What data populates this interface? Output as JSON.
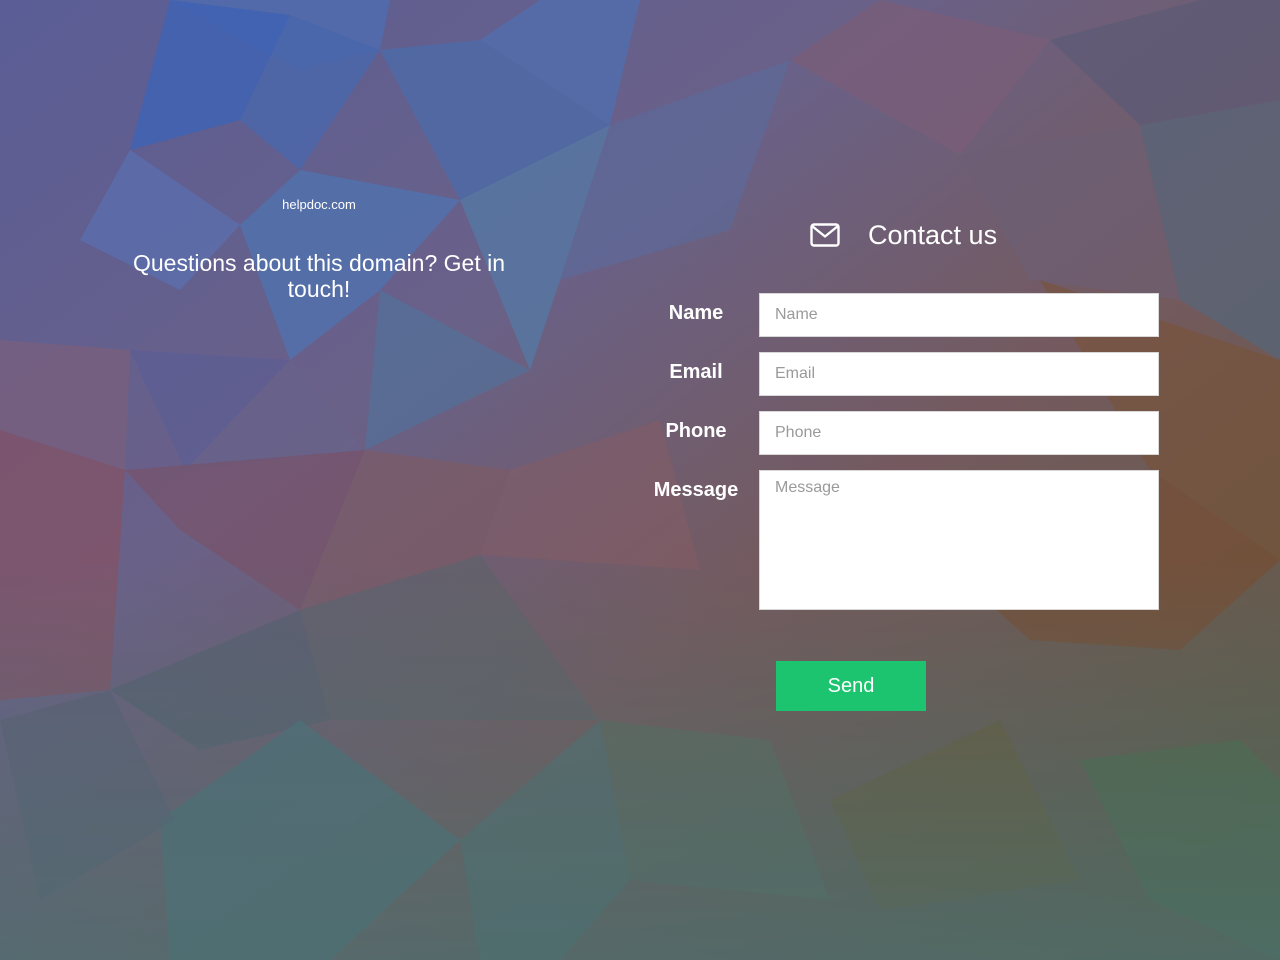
{
  "site": {
    "domain": "helpdoc.com",
    "tagline": "Questions about this domain? Get in touch!"
  },
  "contact": {
    "title": "Contact us",
    "icon": "envelope-icon",
    "fields": {
      "name": {
        "label": "Name",
        "placeholder": "Name",
        "value": ""
      },
      "email": {
        "label": "Email",
        "placeholder": "Email",
        "value": ""
      },
      "phone": {
        "label": "Phone",
        "placeholder": "Phone",
        "value": ""
      },
      "message": {
        "label": "Message",
        "placeholder": "Message",
        "value": ""
      }
    },
    "send_label": "Send"
  },
  "colors": {
    "send_button": "#1dc46f",
    "text": "#ffffff",
    "field_background": "#ffffff",
    "placeholder": "#9a9a9a"
  }
}
